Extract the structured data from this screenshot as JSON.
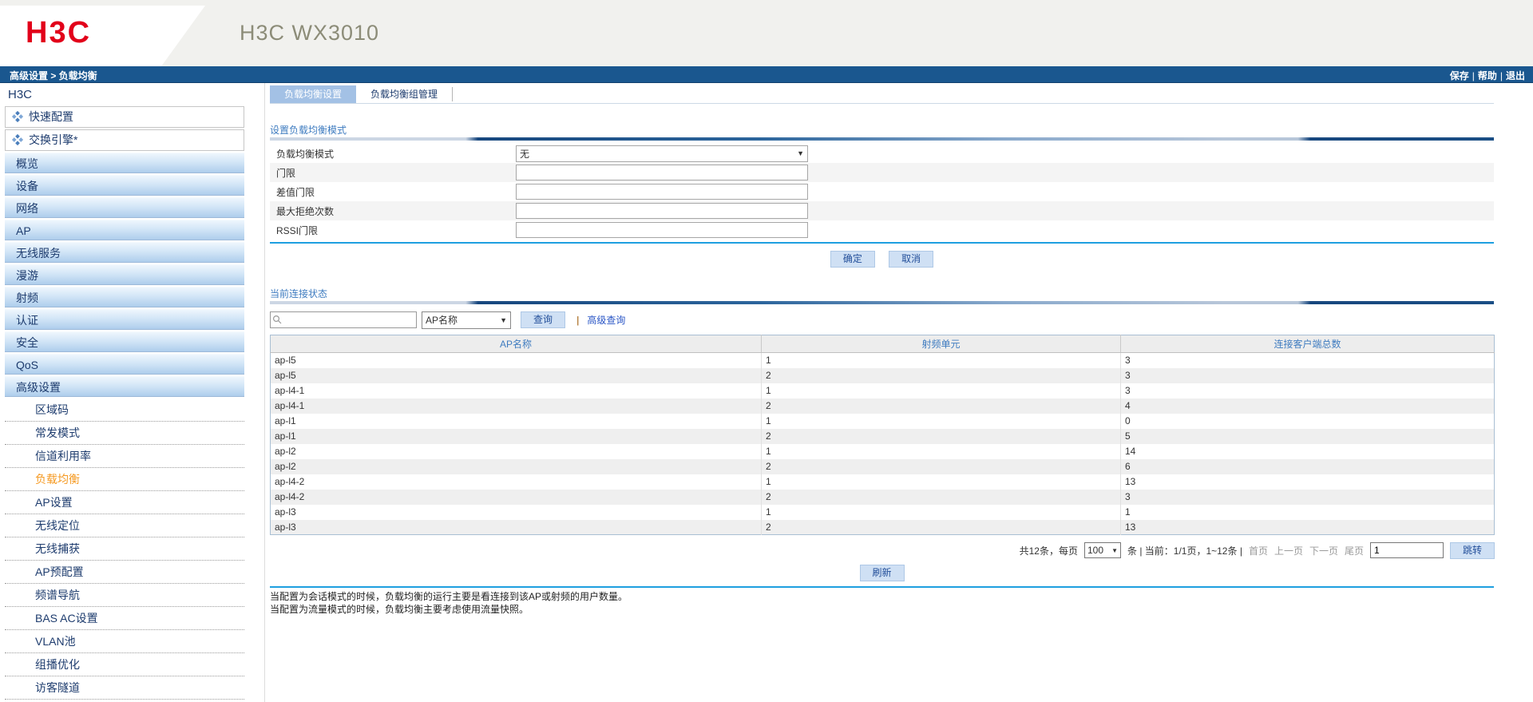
{
  "colors": {
    "topbar_blue": "#1a578f",
    "logo_red": "#e2001a",
    "accent_blue": "#3f7cc0",
    "active_orange": "#f59a23",
    "divider_blue": "#1e9fe0"
  },
  "header": {
    "logo": "H3C",
    "title": "H3C WX3010"
  },
  "topbar": {
    "breadcrumb": "高级设置 > 负载均衡",
    "divider": "|",
    "links": {
      "save": "保存",
      "help": "帮助",
      "logout": "退出"
    }
  },
  "sidebar": {
    "root": "H3C",
    "shortcuts": [
      {
        "label": "快速配置"
      },
      {
        "label": "交换引擎*"
      }
    ],
    "items": [
      "概览",
      "设备",
      "网络",
      "AP",
      "无线服务",
      "漫游",
      "射频",
      "认证",
      "安全",
      "QoS",
      "高级设置"
    ],
    "subitems": [
      {
        "label": "区域码"
      },
      {
        "label": "常发模式"
      },
      {
        "label": "信道利用率"
      },
      {
        "label": "负载均衡"
      },
      {
        "label": "AP设置"
      },
      {
        "label": "无线定位"
      },
      {
        "label": "无线捕获"
      },
      {
        "label": "AP预配置"
      },
      {
        "label": "频谱导航"
      },
      {
        "label": "BAS AC设置"
      },
      {
        "label": "VLAN池"
      },
      {
        "label": "组播优化"
      },
      {
        "label": "访客隧道"
      }
    ]
  },
  "tabs": [
    {
      "label": "负载均衡设置"
    },
    {
      "label": "负载均衡组管理"
    }
  ],
  "mode_section": {
    "title": "设置负载均衡模式",
    "fields": [
      {
        "label": "负载均衡模式",
        "value": "无"
      },
      {
        "label": "门限",
        "value": ""
      },
      {
        "label": "差值门限",
        "value": ""
      },
      {
        "label": "最大拒绝次数",
        "value": ""
      },
      {
        "label": "RSSI门限",
        "value": ""
      }
    ],
    "ok": "确定",
    "cancel": "取消"
  },
  "status_section": {
    "title": "当前连接状态",
    "search_value": "",
    "search_select": "AP名称",
    "query": "查询",
    "divider": "|",
    "advanced_query": "高级查询",
    "table": {
      "headers": [
        "AP名称",
        "射频单元",
        "连接客户端总数"
      ],
      "rows": [
        [
          "ap-l5",
          "1",
          "3"
        ],
        [
          "ap-l5",
          "2",
          "3"
        ],
        [
          "ap-l4-1",
          "1",
          "3"
        ],
        [
          "ap-l4-1",
          "2",
          "4"
        ],
        [
          "ap-l1",
          "1",
          "0"
        ],
        [
          "ap-l1",
          "2",
          "5"
        ],
        [
          "ap-l2",
          "1",
          "14"
        ],
        [
          "ap-l2",
          "2",
          "6"
        ],
        [
          "ap-l4-2",
          "1",
          "13"
        ],
        [
          "ap-l4-2",
          "2",
          "3"
        ],
        [
          "ap-l3",
          "1",
          "1"
        ],
        [
          "ap-l3",
          "2",
          "13"
        ]
      ]
    },
    "pagination": {
      "total_prefix": "共12条，每页",
      "page_size": "100",
      "total_suffix": "条 | 当前：1/1页，1~12条 |",
      "first": "首页",
      "prev": "上一页",
      "next": "下一页",
      "last": "尾页",
      "goto_value": "1",
      "jump": "跳转"
    },
    "refresh": "刷新"
  },
  "notes": [
    "当配置为会话模式的时候，负载均衡的运行主要是看连接到该AP或射频的用户数量。",
    "当配置为流量模式的时候，负载均衡主要考虑使用流量快照。"
  ]
}
